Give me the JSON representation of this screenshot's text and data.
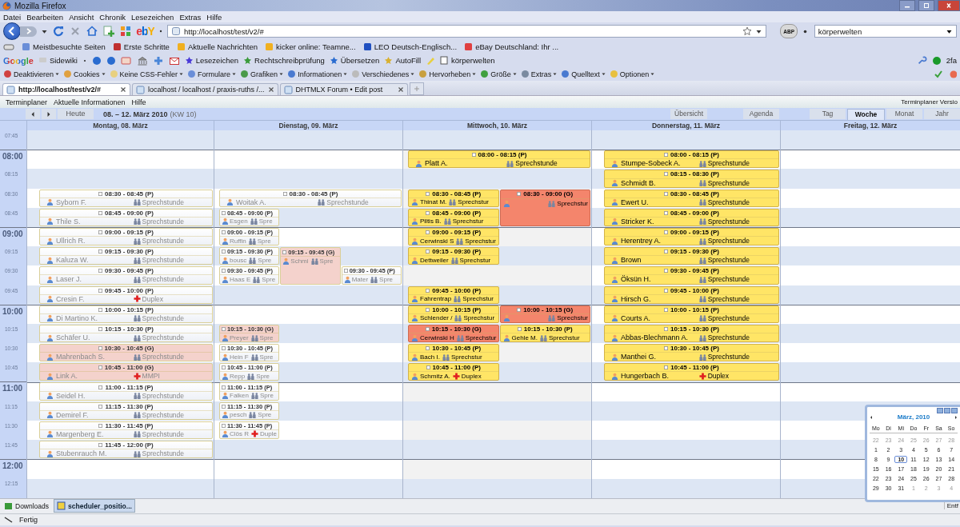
{
  "window": {
    "title": "Mozilla Firefox"
  },
  "menu": [
    "Datei",
    "Bearbeiten",
    "Ansicht",
    "Chronik",
    "Lesezeichen",
    "Extras",
    "Hilfe"
  ],
  "ebay": "ebY",
  "address": {
    "value": "http://localhost/test/v2/#"
  },
  "abp": "ABP",
  "search": {
    "value": "körperwelten"
  },
  "bookmarks": [
    "Meistbesuchte Seiten",
    "Erste Schritte",
    "Aktuelle Nachrichten",
    "kicker online: Teamne...",
    "LEO Deutsch-Englisch...",
    "eBay Deutschland: Ihr ..."
  ],
  "google_toolbar": {
    "logo": "Google",
    "items": [
      "Sidewiki",
      "Lesezeichen",
      "Rechtschreibprüfung",
      "Übersetzen",
      "AutoFill",
      "körperwelten"
    ],
    "status": "2fa"
  },
  "developer_toolbar": [
    "Deaktivieren",
    "Cookies",
    "Keine CSS-Fehler",
    "Formulare",
    "Grafiken",
    "Informationen",
    "Verschiedenes",
    "Hervorheben",
    "Größe",
    "Extras",
    "Quelltext",
    "Optionen"
  ],
  "tabs": [
    {
      "label": "http://localhost/test/v2/#",
      "selected": true
    },
    {
      "label": "localhost / localhost / praxis-ruths /...",
      "selected": false
    },
    {
      "label": "DHTMLX Forum • Edit post",
      "selected": false
    }
  ],
  "app_menu": [
    "Terminplaner",
    "Aktuelle Informationen",
    "Hilfe"
  ],
  "app_version": "Terminplaner Versio",
  "scheduler": {
    "today_button": "Heute",
    "range": "08. – 12. März 2010",
    "week": "(KW 10)",
    "extra_buttons": [
      "Übersicht",
      "Agenda"
    ],
    "views": [
      {
        "label": "Tag",
        "selected": false
      },
      {
        "label": "Woche",
        "selected": true
      },
      {
        "label": "Monat",
        "selected": false
      },
      {
        "label": "Jahr",
        "selected": false
      }
    ]
  },
  "days": [
    {
      "label": "Montag, 08. März",
      "past": true,
      "today": false
    },
    {
      "label": "Dienstag, 09. März",
      "past": true,
      "today": false
    },
    {
      "label": "Mittwoch, 10. März",
      "past": false,
      "today": true
    },
    {
      "label": "Donnerstag, 11. März",
      "past": false,
      "today": false
    },
    {
      "label": "Freitag, 12. März",
      "today": false
    }
  ],
  "rows": [
    {
      "time": "07:45",
      "hour": false
    },
    {
      "time": "08:00",
      "hour": true,
      "cells": [
        [],
        [],
        [
          {
            "time": "08:00 - 08:15 (P)",
            "name": "Platt A.",
            "service": "Sprechstunde",
            "kind": "consultation",
            "group": false,
            "long": false,
            "wide": true
          }
        ],
        [
          {
            "time": "08:00 - 08:15 (P)",
            "name": "Stumpe-Sobeck A.",
            "service": "Sprechstunde",
            "kind": "consultation",
            "group": false,
            "long": false
          }
        ]
      ]
    },
    {
      "time": "08:15",
      "hour": false,
      "cells": [
        [],
        [],
        [],
        [
          {
            "time": "08:15 - 08:30 (P)",
            "name": "Schmidt B.",
            "service": "Sprechstunde",
            "kind": "consultation",
            "group": false,
            "long": false
          }
        ]
      ]
    },
    {
      "time": "08:30",
      "hour": false,
      "cells": [
        [
          {
            "time": "08:30 - 08:45 (P)",
            "name": "Syborn F.",
            "service": "Sprechstunde",
            "kind": "consultation",
            "group": false,
            "long": false
          }
        ],
        [
          {
            "time": "08:30 - 08:45 (P)",
            "name": "Woitak A.",
            "service": "Sprechstunde",
            "kind": "consultation",
            "group": false,
            "long": false,
            "wide": true
          }
        ],
        [
          {
            "time": "08:30 - 08:45 (P)",
            "name": "Thinat M.",
            "service": "Sprechstur",
            "kind": "consultation",
            "group": false,
            "long": false,
            "wide": false
          },
          {
            "time": "08:30 - 09:00 (G)",
            "service": "Sprechstur",
            "kind": "consultation",
            "group": true,
            "long": true,
            "wide": false
          }
        ],
        [
          {
            "time": "08:30 - 08:45 (P)",
            "name": "Ewert U.",
            "service": "Sprechstunde",
            "kind": "consultation",
            "group": false,
            "long": false
          }
        ]
      ]
    },
    {
      "time": "08:45",
      "hour": false,
      "cells": [
        [
          {
            "time": "08:45 - 09:00 (P)",
            "name": "Thile S.",
            "service": "Sprechstunde",
            "kind": "consultation",
            "group": false,
            "long": false
          }
        ],
        [
          {
            "time": "08:45 - 09:00 (P)",
            "name": "Esgen",
            "service": "Spre",
            "kind": "consultation",
            "group": false,
            "long": false,
            "wide": false
          }
        ],
        [
          {
            "time": "08:45 - 09:00 (P)",
            "name": "Piltis B.",
            "service": "Sprechstur",
            "kind": "consultation",
            "group": false,
            "long": false,
            "wide": false
          }
        ],
        [
          {
            "time": "08:45 - 09:00 (P)",
            "name": "Stricker K.",
            "service": "Sprechstunde",
            "kind": "consultation",
            "group": false,
            "long": false
          }
        ]
      ]
    },
    {
      "time": "09:00",
      "hour": true,
      "cells": [
        [
          {
            "time": "09:00 - 09:15 (P)",
            "name": "Ullrich R.",
            "service": "Sprechstunde",
            "kind": "consultation",
            "group": false,
            "long": false
          }
        ],
        [
          {
            "time": "09:00 - 09:15 (P)",
            "name": "Ruffin",
            "service": "Spre",
            "kind": "consultation",
            "group": false,
            "long": false,
            "wide": false
          }
        ],
        [
          {
            "time": "09:00 - 09:15 (P)",
            "name": "Cerwinski S",
            "service": "Sprechstur",
            "kind": "consultation",
            "group": false,
            "long": false,
            "wide": false
          }
        ],
        [
          {
            "time": "09:00 - 09:15 (P)",
            "name": "Herentrey A.",
            "service": "Sprechstunde",
            "kind": "consultation",
            "group": false,
            "long": false
          }
        ]
      ]
    },
    {
      "time": "09:15",
      "hour": false,
      "cells": [
        [
          {
            "time": "09:15 - 09:30 (P)",
            "name": "Kaluza W.",
            "service": "Sprechstunde",
            "kind": "consultation",
            "group": false,
            "long": false
          }
        ],
        [
          {
            "time": "09:15 - 09:30 (P)",
            "name": "bousc",
            "service": "Spre",
            "kind": "consultation",
            "group": false,
            "long": false,
            "wide": false
          },
          {
            "time": "09:15 - 09:45 (G)",
            "name": "Schmi",
            "service": "Spre",
            "kind": "consultation",
            "group": true,
            "long": true,
            "wide": false
          }
        ],
        [
          {
            "time": "09:15 - 09:30 (P)",
            "name": "Dettweiler",
            "service": "Sprechstur",
            "kind": "consultation",
            "group": false,
            "long": false,
            "wide": false
          }
        ],
        [
          {
            "time": "09:15 - 09:30 (P)",
            "name": "Brown",
            "service": "Sprechstunde",
            "kind": "consultation",
            "group": false,
            "long": false
          }
        ]
      ]
    },
    {
      "time": "09:30",
      "hour": false,
      "cells": [
        [
          {
            "time": "09:30 - 09:45 (P)",
            "name": "Laser J.",
            "service": "Sprechstunde",
            "kind": "consultation",
            "group": false,
            "long": false
          }
        ],
        [
          {
            "time": "09:30 - 09:45 (P)",
            "name": "Haas E",
            "service": "Spre",
            "kind": "consultation",
            "group": false,
            "long": false,
            "wide": false
          },
          {
            "time": "09:30 - 09:45 (P)",
            "name": "Mater",
            "service": "Spre",
            "kind": "consultation",
            "group": false,
            "long": false,
            "wide": false
          }
        ],
        [],
        [
          {
            "time": "09:30 - 09:45 (P)",
            "name": "Öksün H.",
            "service": "Sprechstunde",
            "kind": "consultation",
            "group": false,
            "long": false
          }
        ]
      ]
    },
    {
      "time": "09:45",
      "hour": false,
      "cells": [
        [
          {
            "time": "09:45 - 10:00 (P)",
            "name": "Cresin F.",
            "service": "Duplex",
            "kind": "examination",
            "group": false,
            "long": false
          }
        ],
        [],
        [
          {
            "time": "09:45 - 10:00 (P)",
            "name": "Fahrentrap",
            "service": "Sprechstur",
            "kind": "consultation",
            "group": false,
            "long": false,
            "wide": false
          }
        ],
        [
          {
            "time": "09:45 - 10:00 (P)",
            "name": "Hirsch G.",
            "service": "Sprechstunde",
            "kind": "consultation",
            "group": false,
            "long": false
          }
        ]
      ]
    },
    {
      "time": "10:00",
      "hour": true,
      "cells": [
        [
          {
            "time": "10:00 - 10:15 (P)",
            "name": "Di Martino K.",
            "service": "Sprechstunde",
            "kind": "consultation",
            "group": false,
            "long": false
          }
        ],
        [],
        [
          {
            "time": "10:00 - 10:15 (P)",
            "name": "Schlender /",
            "service": "Sprechstur",
            "kind": "consultation",
            "group": false,
            "long": false,
            "wide": false
          },
          {
            "time": "10:00 - 10:15 (G)",
            "service": "Sprechstur",
            "kind": "consultation",
            "group": true,
            "long": false,
            "wide": false
          }
        ],
        [
          {
            "time": "10:00 - 10:15 (P)",
            "name": "Courts A.",
            "service": "Sprechstunde",
            "kind": "consultation",
            "group": false,
            "long": false
          }
        ]
      ]
    },
    {
      "time": "10:15",
      "hour": false,
      "cells": [
        [
          {
            "time": "10:15 - 10:30 (P)",
            "name": "Schäfer U.",
            "service": "Sprechstunde",
            "kind": "consultation",
            "group": false,
            "long": false
          }
        ],
        [
          {
            "time": "10:15 - 10:30 (G)",
            "name": "Preyer",
            "service": "Spre",
            "kind": "consultation",
            "group": true,
            "long": false,
            "wide": false
          }
        ],
        [
          {
            "time": "10:15 - 10:30 (G)",
            "name": "Cerwinski H",
            "service": "Sprechstur",
            "kind": "consultation",
            "group": true,
            "long": false,
            "wide": false
          },
          {
            "time": "10:15 - 10:30 (P)",
            "name": "Gehle M.",
            "service": "Sprechstur",
            "kind": "consultation",
            "group": false,
            "long": false,
            "wide": false
          }
        ],
        [
          {
            "time": "10:15 - 10:30 (P)",
            "name": "Abbas-Blechmann A.",
            "service": "Sprechstunde",
            "kind": "consultation",
            "group": false,
            "long": false
          }
        ]
      ]
    },
    {
      "time": "10:30",
      "hour": false,
      "cells": [
        [
          {
            "time": "10:30 - 10:45 (G)",
            "name": "Mahrenbach S.",
            "service": "Sprechstunde",
            "kind": "consultation",
            "group": true,
            "long": false
          }
        ],
        [
          {
            "time": "10:30 - 10:45 (P)",
            "name": "Hein F",
            "service": "Spre",
            "kind": "consultation",
            "group": false,
            "long": false,
            "wide": false
          }
        ],
        [
          {
            "time": "10:30 - 10:45 (P)",
            "name": "Bach I.",
            "service": "Sprechstur",
            "kind": "consultation",
            "group": false,
            "long": false,
            "wide": false
          }
        ],
        [
          {
            "time": "10:30 - 10:45 (P)",
            "name": "Manthei G.",
            "service": "Sprechstunde",
            "kind": "consultation",
            "group": false,
            "long": false
          }
        ]
      ]
    },
    {
      "time": "10:45",
      "hour": false,
      "cells": [
        [
          {
            "time": "10:45 - 11:00 (G)",
            "name": "Link A.",
            "service": "MMPI",
            "kind": "examination",
            "group": true,
            "long": false
          }
        ],
        [
          {
            "time": "10:45 - 11:00 (P)",
            "name": "Repp",
            "service": "Spre",
            "kind": "consultation",
            "group": false,
            "long": false,
            "wide": false
          }
        ],
        [
          {
            "time": "10:45 - 11:00 (P)",
            "name": "Schmitz A.",
            "service": "Duplex",
            "kind": "examination",
            "group": false,
            "long": false,
            "wide": false
          }
        ],
        [
          {
            "time": "10:45 - 11:00 (P)",
            "name": "Hungerbach B.",
            "service": "Duplex",
            "kind": "examination",
            "group": false,
            "long": false
          }
        ]
      ]
    },
    {
      "time": "11:00",
      "hour": true,
      "cells": [
        [
          {
            "time": "11:00 - 11:15 (P)",
            "name": "Seidel H.",
            "service": "Sprechstunde",
            "kind": "consultation",
            "group": false,
            "long": false
          }
        ],
        [
          {
            "time": "11:00 - 11:15 (P)",
            "name": "Falken",
            "service": "Spre",
            "kind": "consultation",
            "group": false,
            "long": false,
            "wide": false
          }
        ]
      ]
    },
    {
      "time": "11:15",
      "hour": false,
      "cells": [
        [
          {
            "time": "11:15 - 11:30 (P)",
            "name": "Demirel F.",
            "service": "Sprechstunde",
            "kind": "consultation",
            "group": false,
            "long": false
          }
        ],
        [
          {
            "time": "11:15 - 11:30 (P)",
            "name": "pesch",
            "service": "Spre",
            "kind": "consultation",
            "group": false,
            "long": false,
            "wide": false
          }
        ]
      ]
    },
    {
      "time": "11:30",
      "hour": false,
      "cells": [
        [
          {
            "time": "11:30 - 11:45 (P)",
            "name": "Margenberg E.",
            "service": "Sprechstunde",
            "kind": "consultation",
            "group": false,
            "long": false
          }
        ],
        [
          {
            "time": "11:30 - 11:45 (P)",
            "name": "Clös R",
            "service": "Duple",
            "kind": "examination",
            "group": false,
            "long": false,
            "wide": false
          }
        ]
      ]
    },
    {
      "time": "11:45",
      "hour": false,
      "cells": [
        [
          {
            "time": "11:45 - 12:00 (P)",
            "name": "Stubenrauch M.",
            "service": "Sprechstunde",
            "kind": "consultation",
            "group": false,
            "long": false
          }
        ]
      ]
    },
    {
      "time": "12:00",
      "hour": true
    },
    {
      "time": "12:15",
      "hour": false
    }
  ],
  "mini_calendar": {
    "title": "März, 2010",
    "weekdays": [
      "Mo",
      "Di",
      "Mi",
      "Do",
      "Fr",
      "Sa",
      "So"
    ],
    "weeks": [
      [
        {
          "d": "22",
          "other": true,
          "selected": false
        },
        {
          "d": "23",
          "other": true,
          "selected": false
        },
        {
          "d": "24",
          "other": true,
          "selected": false
        },
        {
          "d": "25",
          "other": true,
          "selected": false
        },
        {
          "d": "26",
          "other": true,
          "selected": false
        },
        {
          "d": "27",
          "other": true,
          "selected": false
        },
        {
          "d": "28",
          "other": true,
          "selected": false
        }
      ],
      [
        {
          "d": "1",
          "other": false,
          "selected": false
        },
        {
          "d": "2",
          "other": false,
          "selected": false
        },
        {
          "d": "3",
          "other": false,
          "selected": false
        },
        {
          "d": "4",
          "other": false,
          "selected": false
        },
        {
          "d": "5",
          "other": false,
          "selected": false
        },
        {
          "d": "6",
          "other": false,
          "selected": false
        },
        {
          "d": "7",
          "other": false,
          "selected": false
        }
      ],
      [
        {
          "d": "8",
          "other": false,
          "selected": false
        },
        {
          "d": "9",
          "other": false,
          "selected": false
        },
        {
          "d": "10",
          "other": false,
          "selected": true
        },
        {
          "d": "11",
          "other": false,
          "selected": false
        },
        {
          "d": "12",
          "other": false,
          "selected": false
        },
        {
          "d": "13",
          "other": false,
          "selected": false
        },
        {
          "d": "14",
          "other": false,
          "selected": false
        }
      ],
      [
        {
          "d": "15",
          "other": false,
          "selected": false
        },
        {
          "d": "16",
          "other": false,
          "selected": false
        },
        {
          "d": "17",
          "other": false,
          "selected": false
        },
        {
          "d": "18",
          "other": false,
          "selected": false
        },
        {
          "d": "19",
          "other": false,
          "selected": false
        },
        {
          "d": "20",
          "other": false,
          "selected": false
        },
        {
          "d": "21",
          "other": false,
          "selected": false
        }
      ],
      [
        {
          "d": "22",
          "other": false,
          "selected": false
        },
        {
          "d": "23",
          "other": false,
          "selected": false
        },
        {
          "d": "24",
          "other": false,
          "selected": false
        },
        {
          "d": "25",
          "other": false,
          "selected": false
        },
        {
          "d": "26",
          "other": false,
          "selected": false
        },
        {
          "d": "27",
          "other": false,
          "selected": false
        },
        {
          "d": "28",
          "other": false,
          "selected": false
        }
      ],
      [
        {
          "d": "29",
          "other": false,
          "selected": false
        },
        {
          "d": "30",
          "other": false,
          "selected": false
        },
        {
          "d": "31",
          "other": false,
          "selected": false
        },
        {
          "d": "1",
          "other": true,
          "selected": false
        },
        {
          "d": "2",
          "other": true,
          "selected": false
        },
        {
          "d": "3",
          "other": true,
          "selected": false
        },
        {
          "d": "4",
          "other": true,
          "selected": false
        }
      ]
    ]
  },
  "downloads": {
    "label": "Downloads",
    "file": "scheduler_positio...",
    "right": "Entf"
  },
  "status": "Fertig"
}
